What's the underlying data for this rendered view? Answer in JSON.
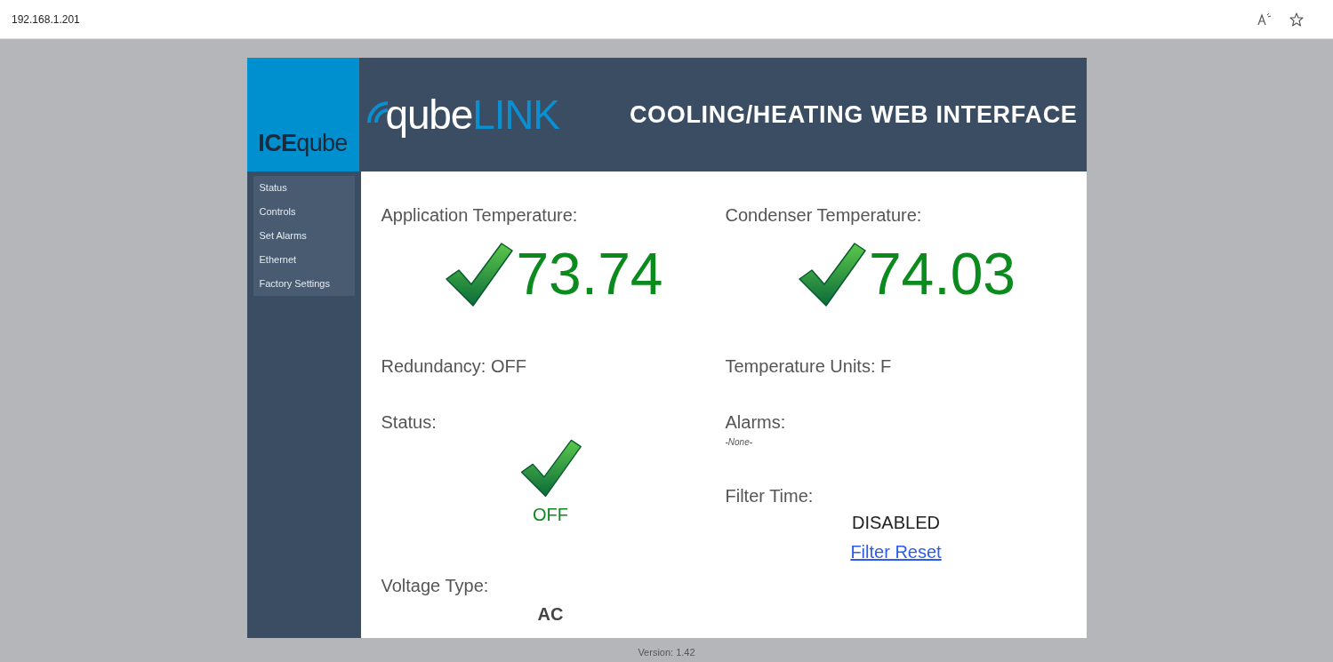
{
  "browser": {
    "url": "192.168.1.201"
  },
  "brand": {
    "logo_left": "ICE",
    "logo_right": "qube",
    "product_left": "qube",
    "product_right": "LINK",
    "title": "COOLING/HEATING WEB INTERFACE"
  },
  "sidebar": {
    "items": [
      {
        "label": "Status"
      },
      {
        "label": "Controls"
      },
      {
        "label": "Set Alarms"
      },
      {
        "label": "Ethernet"
      },
      {
        "label": "Factory Settings"
      }
    ]
  },
  "temperatures": [
    {
      "label": "Application Temperature:",
      "value": "73.74"
    },
    {
      "label": "Condenser Temperature:",
      "value": "74.03"
    }
  ],
  "redundancy": "Redundancy: OFF",
  "temperature_units": "Temperature Units: F",
  "status": {
    "label": "Status:",
    "value": "OFF"
  },
  "alarms": {
    "label": "Alarms:",
    "value": "-None-"
  },
  "filter_time": {
    "label": "Filter Time:",
    "value": "DISABLED",
    "link": "Filter Reset"
  },
  "voltage_type": {
    "label": "Voltage Type:",
    "value": "AC"
  },
  "footer": "Version: 1.42"
}
